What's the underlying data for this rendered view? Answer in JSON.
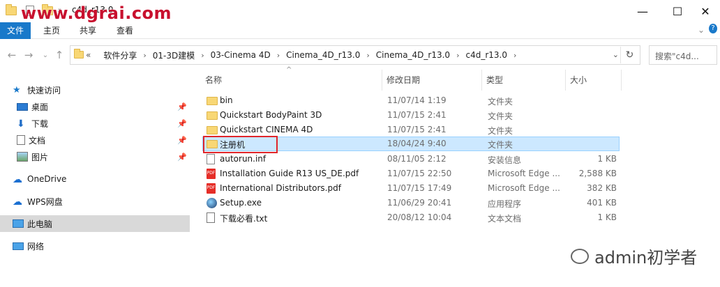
{
  "window": {
    "title": "c4d_r13.0",
    "watermark": "www.dgrai.com"
  },
  "ribbon": {
    "tabs": [
      "文件",
      "主页",
      "共享",
      "查看"
    ],
    "active": 0
  },
  "address": {
    "crumbs": [
      "«",
      "软件分享",
      "01-3D建模",
      "03-Cinema 4D",
      "Cinema_4D_r13.0",
      "Cinema_4D_r13.0",
      "c4d_r13.0"
    ],
    "search_placeholder": "搜索\"c4d..."
  },
  "nav": {
    "items": [
      {
        "label": "快速访问",
        "icon": "star-icon"
      },
      {
        "label": "桌面",
        "icon": "desktop-icon",
        "pinned": true
      },
      {
        "label": "下载",
        "icon": "download-icon",
        "pinned": true
      },
      {
        "label": "文档",
        "icon": "document-icon",
        "pinned": true
      },
      {
        "label": "图片",
        "icon": "pictures-icon",
        "pinned": true
      },
      {
        "label": "OneDrive",
        "icon": "cloud-icon"
      },
      {
        "label": "WPS网盘",
        "icon": "cloud-icon"
      },
      {
        "label": "此电脑",
        "icon": "computer-icon",
        "selected": true
      },
      {
        "label": "网络",
        "icon": "network-icon"
      }
    ]
  },
  "columns": {
    "name": "名称",
    "date": "修改日期",
    "type": "类型",
    "size": "大小"
  },
  "files": [
    {
      "name": "bin",
      "date": "11/07/14 1:19",
      "type": "文件夹",
      "size": "",
      "icon": "folder-icon"
    },
    {
      "name": "Quickstart BodyPaint 3D",
      "date": "11/07/15 2:41",
      "type": "文件夹",
      "size": "",
      "icon": "folder-icon"
    },
    {
      "name": "Quickstart CINEMA 4D",
      "date": "11/07/15 2:41",
      "type": "文件夹",
      "size": "",
      "icon": "folder-icon"
    },
    {
      "name": "注册机",
      "date": "18/04/24 9:40",
      "type": "文件夹",
      "size": "",
      "icon": "folder-icon",
      "selected": true
    },
    {
      "name": "autorun.inf",
      "date": "08/11/05 2:12",
      "type": "安装信息",
      "size": "1 KB",
      "icon": "settings-file-icon"
    },
    {
      "name": "Installation Guide R13 US_DE.pdf",
      "date": "11/07/15 22:50",
      "type": "Microsoft Edge ...",
      "size": "2,588 KB",
      "icon": "pdf-icon"
    },
    {
      "name": "International Distributors.pdf",
      "date": "11/07/15 17:49",
      "type": "Microsoft Edge ...",
      "size": "382 KB",
      "icon": "pdf-icon"
    },
    {
      "name": "Setup.exe",
      "date": "11/06/29 20:41",
      "type": "应用程序",
      "size": "401 KB",
      "icon": "cinema4d-app-icon"
    },
    {
      "name": "下载必看.txt",
      "date": "20/08/12 10:04",
      "type": "文本文档",
      "size": "1 KB",
      "icon": "text-file-icon"
    }
  ],
  "brand": {
    "text": "admin初学者"
  },
  "colors": {
    "accent": "#1979ca",
    "selection": "#cce8ff",
    "highlight": "#e0262b"
  }
}
